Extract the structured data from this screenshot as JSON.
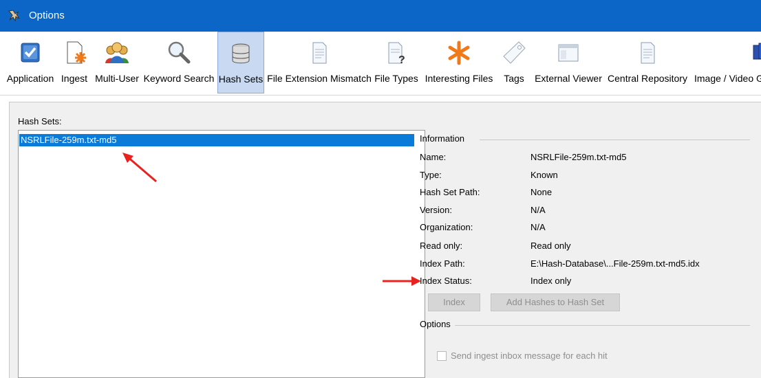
{
  "window": {
    "title": "Options",
    "icon": "autopsy-dog-icon"
  },
  "toolbar": {
    "items": [
      {
        "label": "Application",
        "icon": "application-checkbox-icon"
      },
      {
        "label": "Ingest",
        "icon": "ingest-document-star-icon"
      },
      {
        "label": "Multi-User",
        "icon": "multi-user-people-icon"
      },
      {
        "label": "Keyword Search",
        "icon": "magnifier-icon"
      },
      {
        "label": "Hash Sets",
        "icon": "database-icon",
        "active": true
      },
      {
        "label": "File Extension Mismatch",
        "icon": "document-icon"
      },
      {
        "label": "File Types",
        "icon": "document-question-icon"
      },
      {
        "label": "Interesting Files",
        "icon": "orange-asterisk-icon"
      },
      {
        "label": "Tags",
        "icon": "tag-icon"
      },
      {
        "label": "External Viewer",
        "icon": "window-viewer-icon"
      },
      {
        "label": "Central Repository",
        "icon": "document-icon"
      },
      {
        "label": "Image / Video G",
        "icon": "image-gallery-icon"
      }
    ]
  },
  "hash_sets": {
    "label": "Hash Sets:",
    "items": [
      {
        "name": "NSRLFile-259m.txt-md5",
        "selected": true
      }
    ]
  },
  "information": {
    "title": "Information",
    "fields": [
      {
        "label": "Name:",
        "value": "NSRLFile-259m.txt-md5"
      },
      {
        "label": "Type:",
        "value": "Known"
      },
      {
        "label": "Hash Set Path:",
        "value": "None"
      },
      {
        "label": "Version:",
        "value": "N/A"
      },
      {
        "label": "Organization:",
        "value": "N/A"
      },
      {
        "label": "Read only:",
        "value": "Read only"
      },
      {
        "label": "Index Path:",
        "value": "E:\\Hash-Database\\...File-259m.txt-md5.idx"
      },
      {
        "label": "Index Status:",
        "value": "Index only"
      }
    ],
    "index_button": "Index",
    "add_hashes_button": "Add Hashes to Hash Set"
  },
  "options": {
    "title": "Options",
    "send_ingest_inbox_label": "Send ingest inbox message for each hit",
    "send_ingest_inbox_checked": false
  },
  "annotations": {
    "arrow_color": "#e8231f"
  }
}
